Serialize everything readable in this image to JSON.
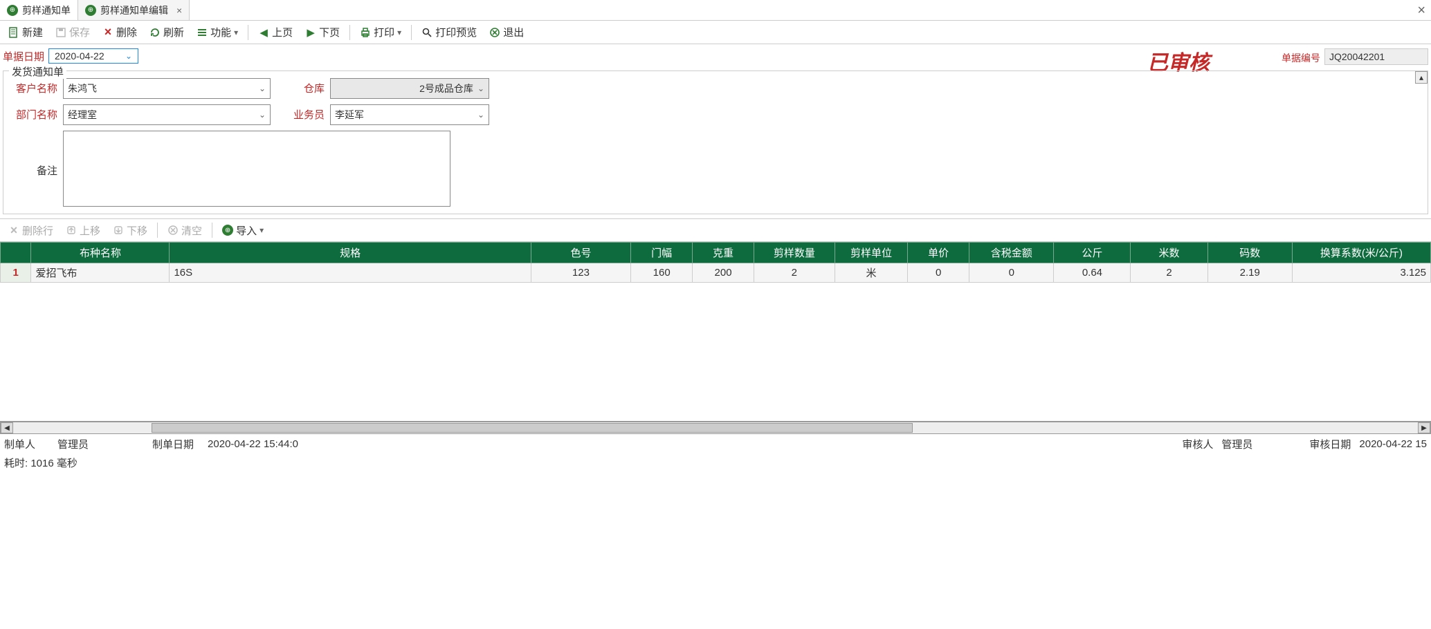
{
  "tabs": [
    {
      "label": "剪样通知单"
    },
    {
      "label": "剪样通知单编辑"
    }
  ],
  "toolbar": {
    "new": "新建",
    "save": "保存",
    "delete": "删除",
    "refresh": "刷新",
    "functions": "功能",
    "prev": "上页",
    "next": "下页",
    "print": "打印",
    "preview": "打印预览",
    "exit": "退出"
  },
  "header": {
    "date_label": "单据日期",
    "date_value": "2020-04-22",
    "audit_stamp": "已审核",
    "doc_no_label": "单据编号",
    "doc_no_value": "JQ20042201"
  },
  "fieldset": {
    "legend": "发货通知单",
    "customer_label": "客户名称",
    "customer_value": "朱鸿飞",
    "warehouse_label": "仓库",
    "warehouse_value": "2号成品仓库",
    "dept_label": "部门名称",
    "dept_value": "经理室",
    "salesperson_label": "业务员",
    "salesperson_value": "李延军",
    "remark_label": "备注",
    "remark_value": ""
  },
  "sub_toolbar": {
    "delete_row": "删除行",
    "move_up": "上移",
    "move_down": "下移",
    "clear": "清空",
    "import": "导入"
  },
  "table": {
    "columns": [
      "布种名称",
      "规格",
      "色号",
      "门幅",
      "克重",
      "剪样数量",
      "剪样单位",
      "单价",
      "含税金额",
      "公斤",
      "米数",
      "码数",
      "换算系数(米/公斤)"
    ],
    "rows": [
      {
        "num": "1",
        "cloth": "爱招飞布",
        "spec": "16S",
        "color_no": "123",
        "width": "160",
        "weight": "200",
        "qty": "2",
        "unit": "米",
        "price": "0",
        "amount": "0",
        "kg": "0.64",
        "meters": "2",
        "yards": "2.19",
        "ratio": "3.125"
      }
    ]
  },
  "footer": {
    "creator_label": "制单人",
    "creator_value": "管理员",
    "create_date_label": "制单日期",
    "create_date_value": "2020-04-22 15:44:0",
    "auditor_label": "审核人",
    "auditor_value": "管理员",
    "audit_date_label": "审核日期",
    "audit_date_value": "2020-04-22 15"
  },
  "status": {
    "elapsed": "耗时: 1016 毫秒"
  }
}
